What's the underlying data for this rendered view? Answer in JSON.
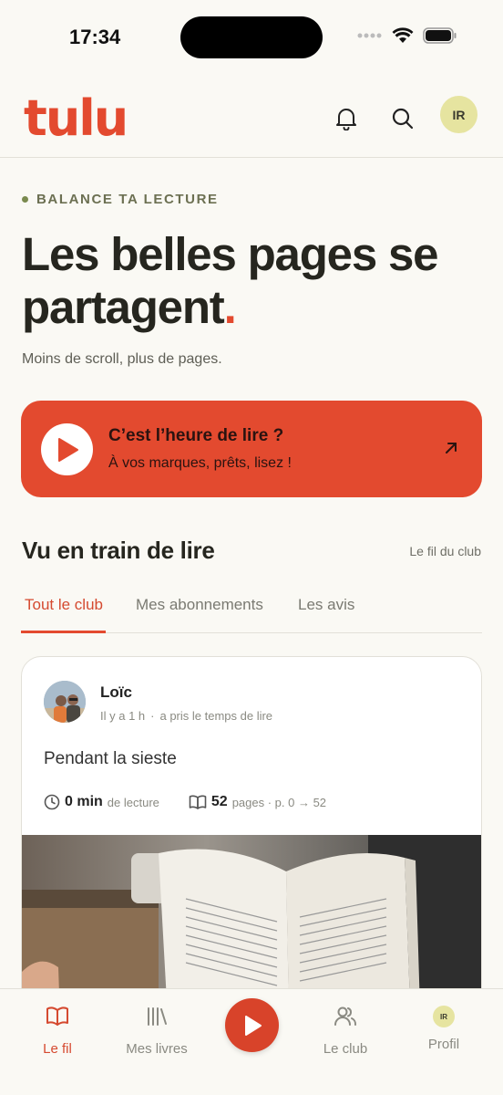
{
  "status_bar": {
    "time": "17:34"
  },
  "header": {
    "logo_text": "tulu",
    "avatar_initials": "IR",
    "icons": [
      "bell-icon",
      "search-icon"
    ]
  },
  "hero": {
    "eyebrow": "BALANCE TA LECTURE",
    "title_main": "Les belles pages se partagent",
    "title_accent": ".",
    "subtitle": "Moins de scroll, plus de pages."
  },
  "cta": {
    "title": "C’est l’heure de lire ?",
    "subtitle": "À vos marques, prêts, lisez !"
  },
  "section": {
    "title": "Vu en train de lire",
    "link": "Le fil du club",
    "tabs": [
      "Tout le club",
      "Mes abonnements",
      "Les avis"
    ],
    "active_tab": "Tout le club"
  },
  "post": {
    "author": "Loïc",
    "time": "Il y a 1 h",
    "action": "a pris le temps de lire",
    "text": "Pendant la sieste",
    "minutes": "0 min",
    "minutes_label": "de lecture",
    "pages": "52",
    "pages_label": "pages · p. 0 → 52"
  },
  "bottom_nav": {
    "items": [
      {
        "label": "Le fil"
      },
      {
        "label": "Mes livres"
      },
      {
        "label": "Le club"
      },
      {
        "label": "Profil"
      }
    ],
    "avatar_initials": "IR"
  },
  "colors": {
    "accent": "#e34a2f",
    "background": "#faf9f4",
    "avatar_bg": "#e6e4a0"
  }
}
